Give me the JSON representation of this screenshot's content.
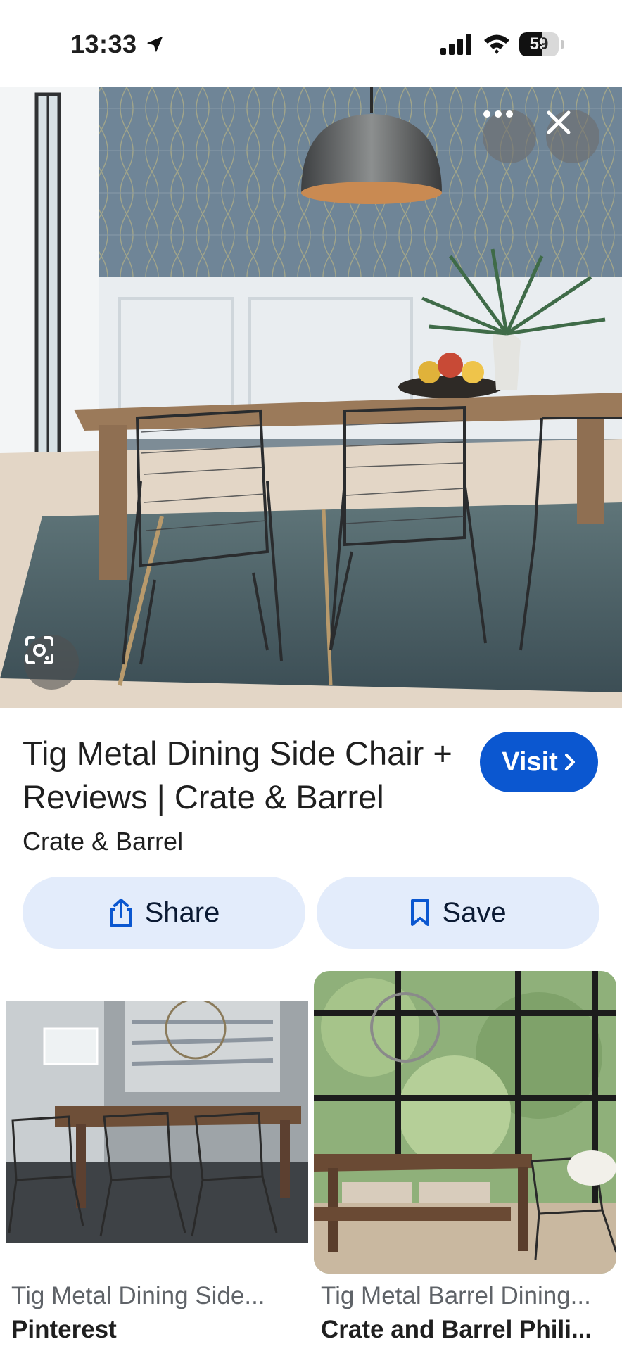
{
  "status_bar": {
    "time": "13:33",
    "battery": "59",
    "battery_level": 0.59
  },
  "hero": {
    "alt": "Dining room with Tig metal chairs",
    "more_icon": "more-horizontal-icon",
    "close_icon": "close-icon",
    "lens_icon": "google-lens-icon"
  },
  "result": {
    "title": "Tig Metal Dining Side Chair + Reviews | Crate & Barrel",
    "source": "Crate & Barrel",
    "visit_label": "Visit",
    "share_label": "Share",
    "save_label": "Save"
  },
  "related": [
    {
      "caption": "Tig Metal Dining Side...",
      "source": "Pinterest"
    },
    {
      "caption": "Tig Metal Barrel Dining...",
      "source": "Crate and Barrel Phili..."
    }
  ],
  "colors": {
    "accent": "#0b57d0",
    "pill_bg": "#e3ecfb"
  }
}
